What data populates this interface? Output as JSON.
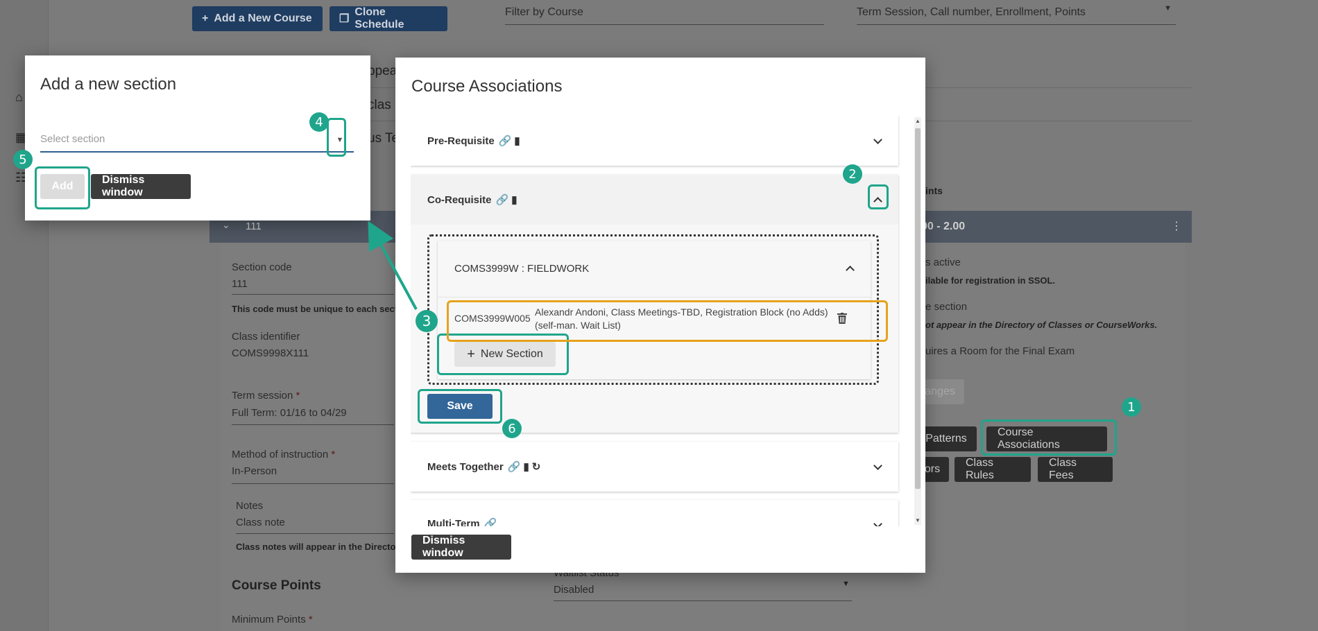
{
  "background": {
    "toolbar": {
      "add_course_label": "Add a New Course",
      "clone_schedule_label": "Clone Schedule",
      "filter_placeholder": "Filter by Course",
      "sort_value": "Term Session, Call number, Enrollment, Points"
    },
    "snippets": {
      "appear": "ppear",
      "class": "clas",
      "us_te": "us Te",
      "points_header": "ints",
      "section_number": "111",
      "points_range": "00  -  2.00"
    },
    "form": {
      "section_code_label": "Section code",
      "section_code_value": "111",
      "section_code_help": "This code must be unique to each sectio",
      "class_identifier_label": "Class identifier",
      "class_identifier_value": "COMS9998X111",
      "term_session_label": "Term session",
      "term_session_value": "Full Term: 01/16 to 04/29",
      "method_label": "Method of instruction",
      "method_value": "In-Person",
      "notes_label": "Notes",
      "notes_placeholder": "Class note",
      "notes_help": "Class notes will appear in the Directory",
      "course_points_heading": "Course Points",
      "min_points_label": "Minimum Points",
      "waitlist_label": "Waitlist Status",
      "waitlist_value": "Disabled",
      "required_mark": "*"
    },
    "right_col": {
      "active_text": "s active",
      "available_text": "ilable for registration in SSOL.",
      "section_text": "e section",
      "directory_text": "ot appear in the Directory of Classes or CourseWorks.",
      "room_text": "uires a Room for the Final Exam",
      "changes_label": "anges",
      "patterns_label": "Patterns",
      "course_assoc_label": "Course Associations",
      "ors_label": "ors",
      "class_rules_label": "Class Rules",
      "class_fees_label": "Class Fees"
    }
  },
  "add_section_modal": {
    "title": "Add a new section",
    "select_placeholder": "Select section",
    "add_label": "Add",
    "dismiss_label": "Dismiss window"
  },
  "course_assoc_modal": {
    "title": "Course Associations",
    "accordions": [
      {
        "label": "Pre-Requisite"
      },
      {
        "label": "Co-Requisite"
      },
      {
        "label": "Meets Together"
      },
      {
        "label": "Multi-Term"
      }
    ],
    "course": {
      "label": "COMS3999W : FIELDWORK",
      "section_code": "COMS3999W005",
      "section_desc": "Alexandr Andoni, Class Meetings-TBD, Registration Block (no Adds) (self-man. Wait List)"
    },
    "new_section_label": "New Section",
    "save_label": "Save",
    "dismiss_label": "Dismiss window"
  },
  "callouts": {
    "badges": [
      "1",
      "2",
      "3",
      "4",
      "5",
      "6"
    ]
  },
  "colors": {
    "accent_teal": "#1fa58b",
    "highlight_orange": "#e6a21d",
    "primary_blue": "#336699"
  }
}
